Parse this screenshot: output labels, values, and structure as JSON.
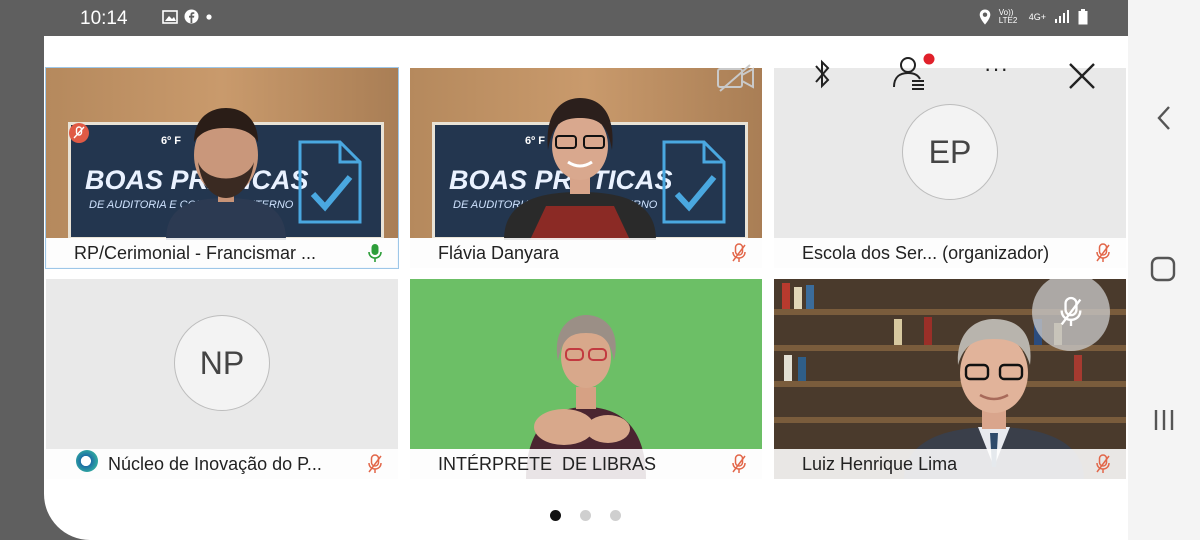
{
  "status_bar": {
    "time": "10:14",
    "left_icons": [
      "gallery-icon",
      "facebook-icon",
      "dot-icon"
    ],
    "right_icons": [
      "location-icon",
      "volte-icon",
      "signal-icon",
      "battery-icon"
    ],
    "network_text": "Vo)) LTE2",
    "data_text": "4G+"
  },
  "toolbar": {
    "icons": [
      "camera-off-icon",
      "bluetooth-icon",
      "participants-icon",
      "more-icon",
      "close-icon"
    ],
    "more_label": "···"
  },
  "tiles": [
    {
      "name": "RP/Cerimonial - Francismar ...",
      "mic": "active",
      "mic_color": "#2e9e3a",
      "muted_badge": true,
      "banner_title": "BOAS PRÁTICAS",
      "banner_sub": "DE AUDITORIA E CONTROLE INTERNO",
      "banner_edition": "6º F"
    },
    {
      "name": "Flávia Danyara",
      "mic": "muted",
      "banner_title": "BOAS PRÁTICAS",
      "banner_sub": "DE AUDITORIA E CONTROLE INTERNO",
      "banner_edition": "6º F"
    },
    {
      "name": "Escola dos Ser... (organizador)",
      "mic": "muted",
      "avatar": "EP"
    },
    {
      "name": "Núcleo de Inovação do P...",
      "mic": "muted",
      "avatar": "NP"
    },
    {
      "name": "INTÉRPRETE  DE LIBRAS",
      "mic": "muted"
    },
    {
      "name": "Luiz Henrique Lima",
      "mic": "muted"
    }
  ],
  "pagination": {
    "pages": 3,
    "current": 1
  },
  "colors": {
    "muted": "#e2674a",
    "active_mic": "#2e9e3a",
    "status_bar": "#5f5f5f"
  }
}
